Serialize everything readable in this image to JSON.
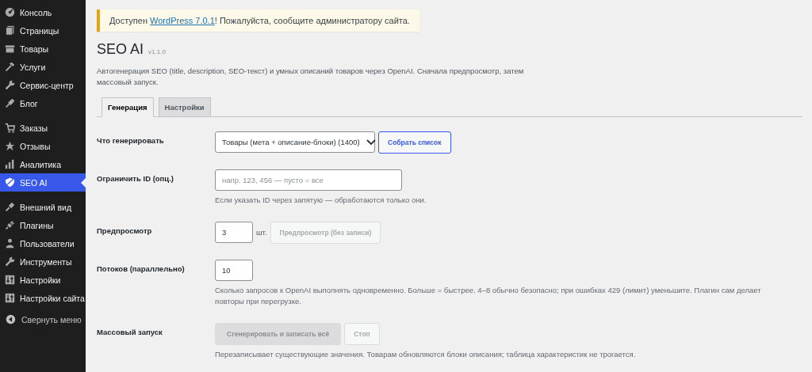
{
  "sidebar": {
    "groups": [
      {
        "items": [
          {
            "label": "Консоль",
            "selected": false
          },
          {
            "label": "Страницы",
            "selected": false
          },
          {
            "label": "Товары",
            "selected": false
          },
          {
            "label": "Услуги",
            "selected": false
          },
          {
            "label": "Сервис-центр",
            "selected": false
          },
          {
            "label": "Блог",
            "selected": false
          }
        ]
      },
      {
        "items": [
          {
            "label": "Заказы",
            "selected": false
          },
          {
            "label": "Отзывы",
            "selected": false
          },
          {
            "label": "Аналитика",
            "selected": false
          },
          {
            "label": "SEO AI",
            "selected": true
          }
        ]
      },
      {
        "items": [
          {
            "label": "Внешний вид",
            "selected": false
          },
          {
            "label": "Плагины",
            "selected": false
          },
          {
            "label": "Пользователи",
            "selected": false
          },
          {
            "label": "Инструменты",
            "selected": false
          },
          {
            "label": "Настройки",
            "selected": false
          },
          {
            "label": "Настройки сайта",
            "selected": false
          }
        ]
      }
    ],
    "collapse": "Свернуть меню"
  },
  "notice": {
    "before": "Доступен ",
    "link": "WordPress 7.0.1",
    "after": "! Пожалуйста, сообщите администратору сайта."
  },
  "page": {
    "title": "SEO AI",
    "version": "v1.1.0",
    "description": "Автогенерация SEO (title, description, SEO-текст) и умных описаний товаров через OpenAI. Сначала предпросмотр, затем массовый запуск."
  },
  "tabs": [
    {
      "label": "Генерация",
      "selected": true
    },
    {
      "label": "Настройки",
      "selected": false
    }
  ],
  "form": {
    "rows": [
      {
        "label": "Что генерировать",
        "controls": [
          {
            "kind": "select",
            "value": "Товары (мета + описание-блоки) (1400)"
          },
          {
            "kind": "button",
            "label": "Собрать список",
            "disabled": false
          }
        ]
      },
      {
        "label": "Ограничить ID (опц.)",
        "controls": [
          {
            "kind": "text",
            "placeholder": "напр. 123, 456 — пусто = все"
          }
        ],
        "help": "Если указать ID через запятую — обработаются только они."
      },
      {
        "label": "Предпросмотр",
        "controls": [
          {
            "kind": "number",
            "value": "3"
          },
          {
            "kind": "unit",
            "text": "шт."
          },
          {
            "kind": "button",
            "label": "Предпросмотр (без записи)",
            "disabled": true
          }
        ]
      },
      {
        "label": "Потоков (параллельно)",
        "controls": [
          {
            "kind": "number",
            "value": "10"
          }
        ],
        "help": "Сколько запросов к OpenAI выполнять одновременно. Больше = быстрее. 4–8 обычно безопасно; при ошибках 429 (лимит) уменьшите. Плагин сам делает повторы при перегрузке."
      },
      {
        "label": "Массовый запуск",
        "controls": [
          {
            "kind": "primary",
            "label": "Сгенерировать и записать всё",
            "disabled": true
          },
          {
            "kind": "button",
            "label": "Стоп",
            "disabled": true
          }
        ],
        "help": "Перезаписывает существующие значения. Товарам обновляются блоки описания; таблица характеристик не трогается."
      }
    ]
  }
}
